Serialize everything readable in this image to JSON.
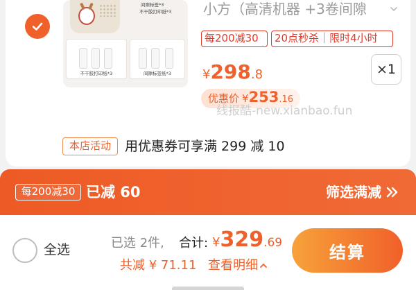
{
  "product": {
    "title": "小方（高清机器 +3卷间隙",
    "thumb_label_a": "间隙标签*3",
    "thumb_label_b": "不干胶打印纸*3",
    "thumb_panel_left": "不干胶打印纸*3",
    "thumb_panel_right": "间隙标签纸*3",
    "promo_tags": [
      "每200减30",
      "20点秒杀｜限时4小时"
    ],
    "price": {
      "symbol": "¥",
      "integer": "298",
      "decimal": ".8"
    },
    "quantity": "×1",
    "coupon": {
      "label": "优惠价",
      "symbol": "¥",
      "integer": "253",
      "decimal": ".16"
    }
  },
  "watermark": "线报酷-new.xianbao.fun",
  "store_activity": {
    "tag": "本店活动",
    "text": "用优惠券可享满 299 减 10"
  },
  "banner": {
    "tag": "每200减30",
    "saved": "已减 60",
    "filter": "筛选满减"
  },
  "footer": {
    "select_all": "全选",
    "selected_count": "已选 2件,",
    "total_label": "合计:",
    "total": {
      "symbol": "¥",
      "integer": "329",
      "decimal": ".69"
    },
    "discount": "共减 ¥ 71.11",
    "detail": "查看明细",
    "checkout": "结算"
  },
  "colors": {
    "accent": "#f0602a",
    "promo_red": "#e03a2a",
    "checkout_start": "#f7a23a"
  }
}
